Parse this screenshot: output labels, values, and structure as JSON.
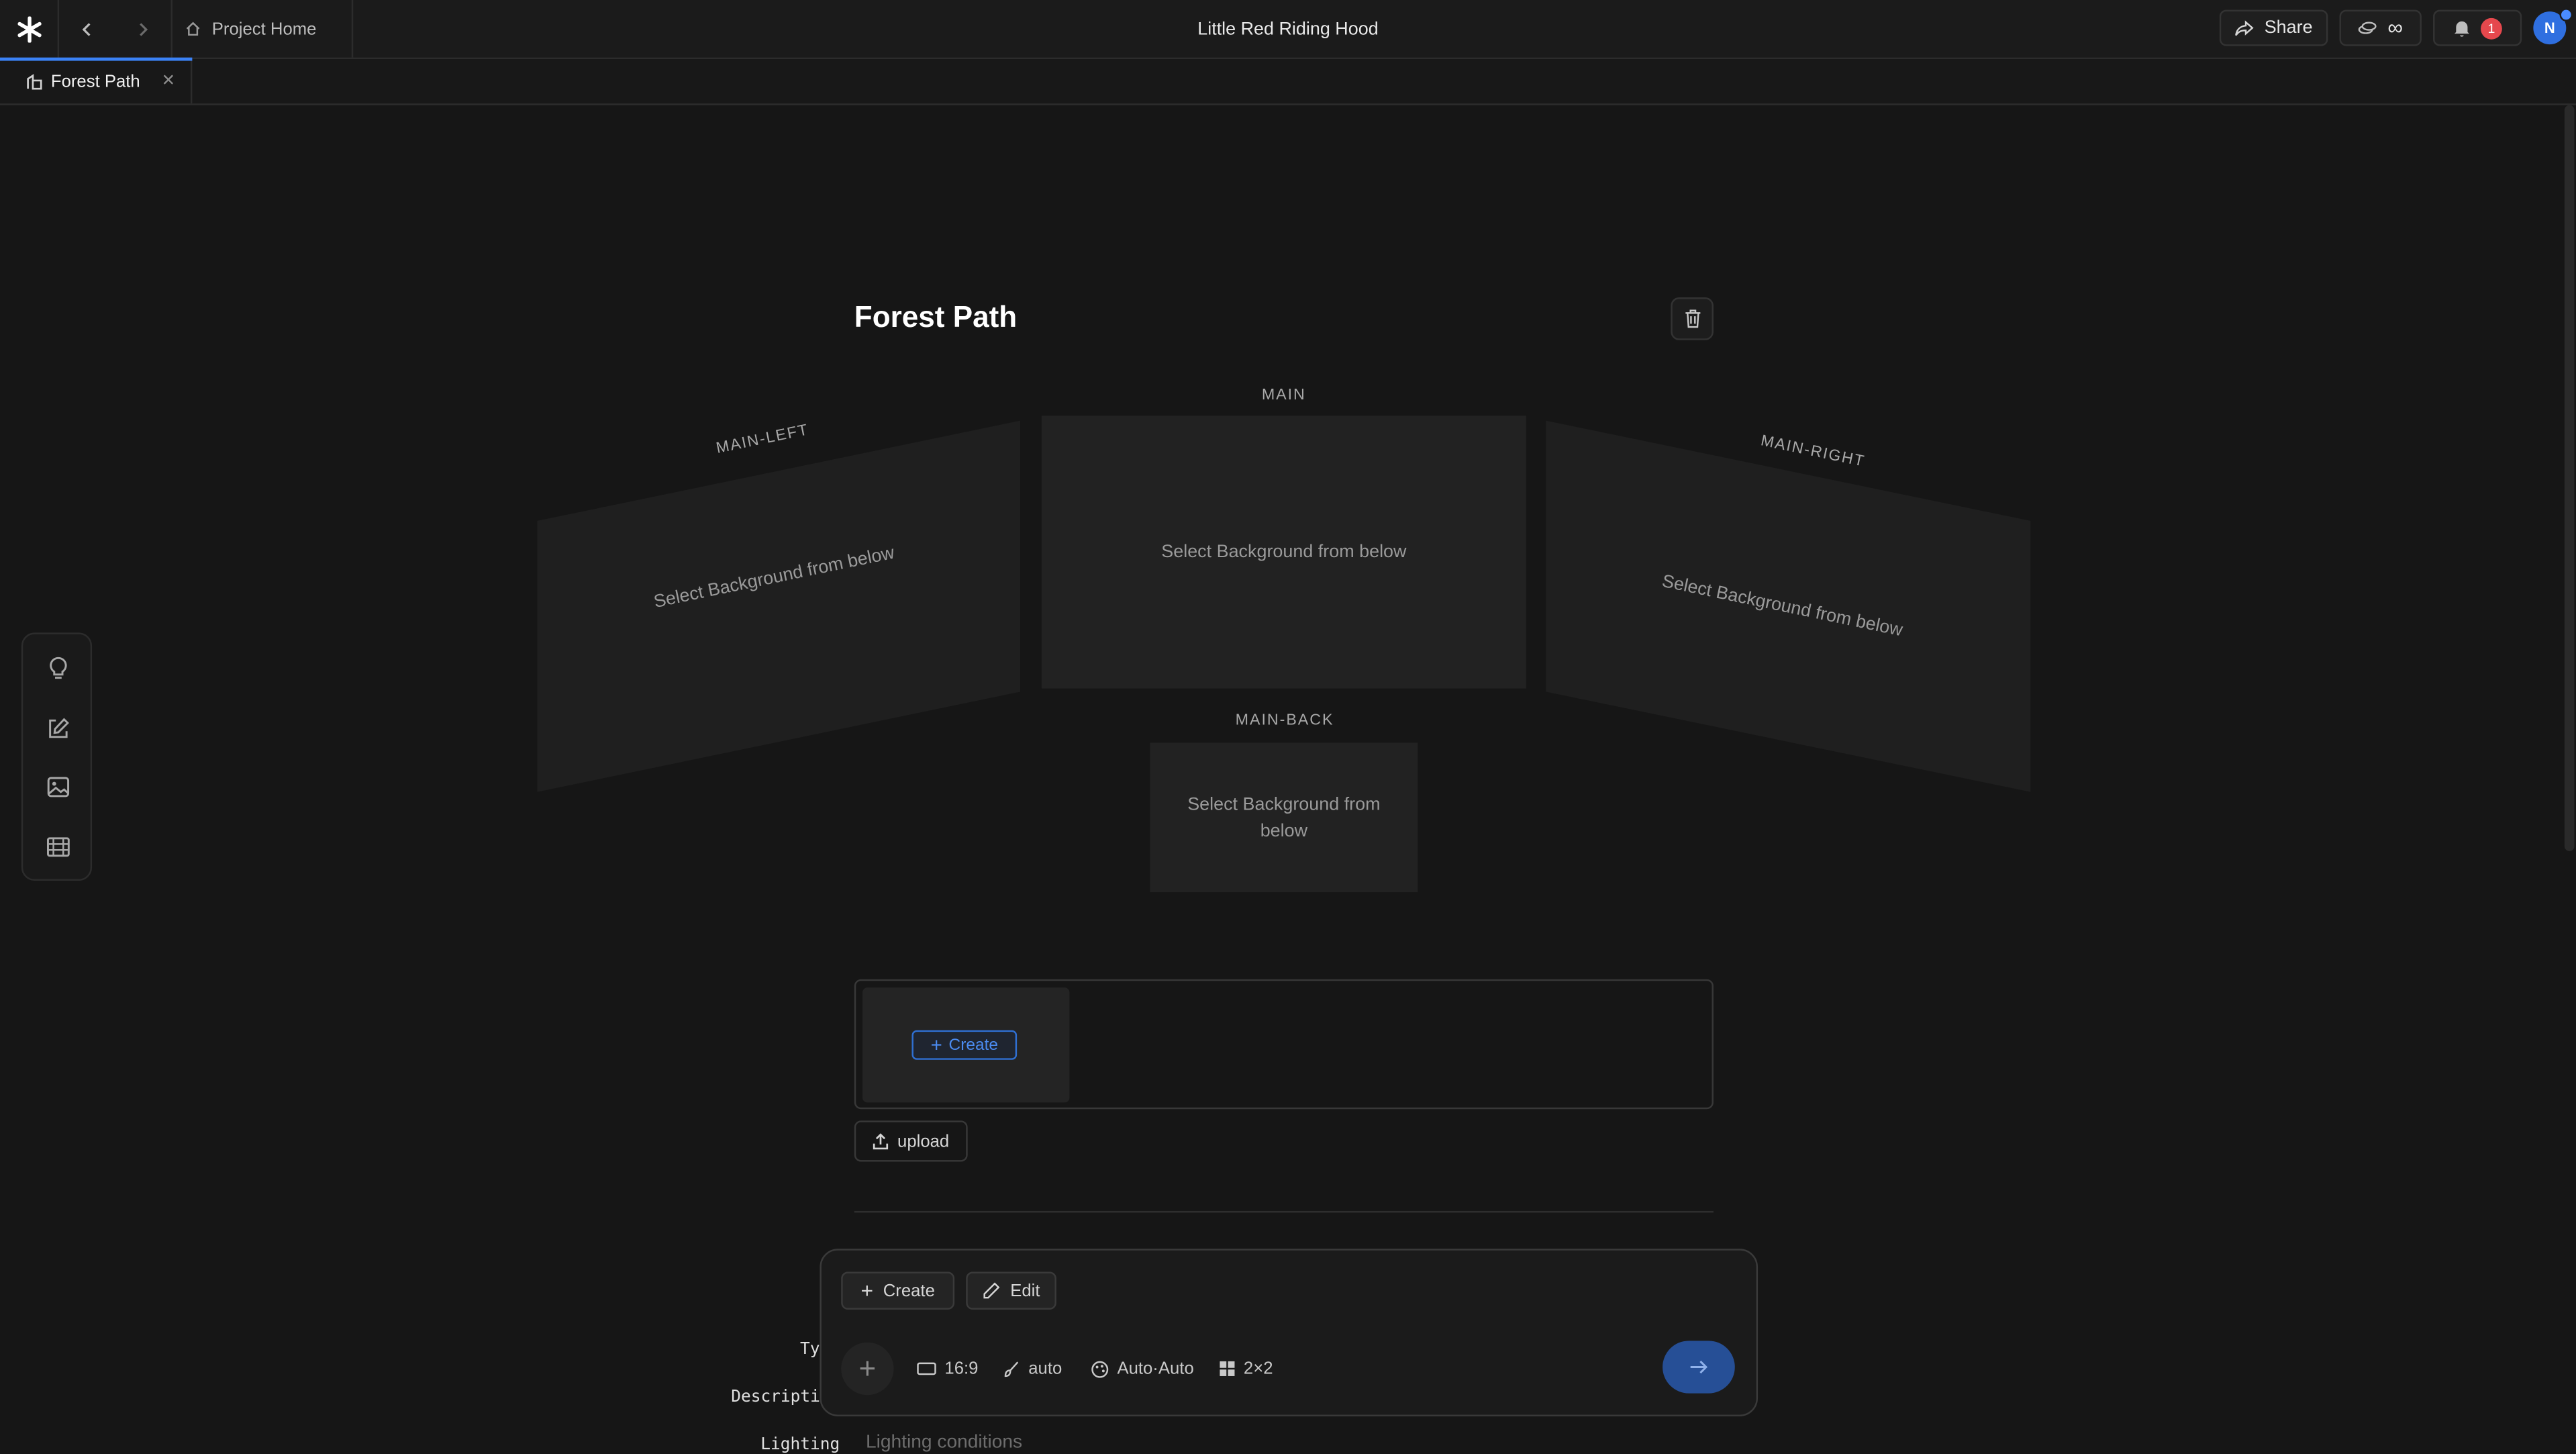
{
  "header": {
    "project_home": "Project Home",
    "title": "Little Red Riding Hood",
    "share": "Share",
    "infinity": "∞",
    "notification_count": "1",
    "avatar_initial": "N"
  },
  "tabs": [
    {
      "label": "Forest Path",
      "active": true
    }
  ],
  "page": {
    "title": "Forest Path"
  },
  "panels": {
    "main_left": {
      "label": "MAIN-LEFT",
      "placeholder": "Select Background from below"
    },
    "main": {
      "label": "MAIN",
      "placeholder": "Select Background from below"
    },
    "main_right": {
      "label": "MAIN-RIGHT",
      "placeholder": "Select Background from below"
    },
    "main_back": {
      "label": "MAIN-BACK",
      "placeholder_line1": "Select Background from",
      "placeholder_line2": "below"
    }
  },
  "picker": {
    "create": "Create",
    "upload": "upload"
  },
  "fields": {
    "type_label": "Ty",
    "description_label": "Descriptio",
    "lighting_label": "Lighting",
    "lighting_placeholder": "Lighting conditions"
  },
  "composer": {
    "create": "Create",
    "edit": "Edit",
    "aspect_ratio": "16:9",
    "style": "auto",
    "model": "Auto·Auto",
    "grid": "2×2"
  },
  "colors": {
    "accent": "#3b82f6",
    "background": "#161616",
    "badge": "#e5484d",
    "send_button": "#264f96"
  },
  "icons": {
    "sidebar": [
      "lightbulb-icon",
      "edit-icon",
      "image-icon",
      "film-icon"
    ]
  }
}
